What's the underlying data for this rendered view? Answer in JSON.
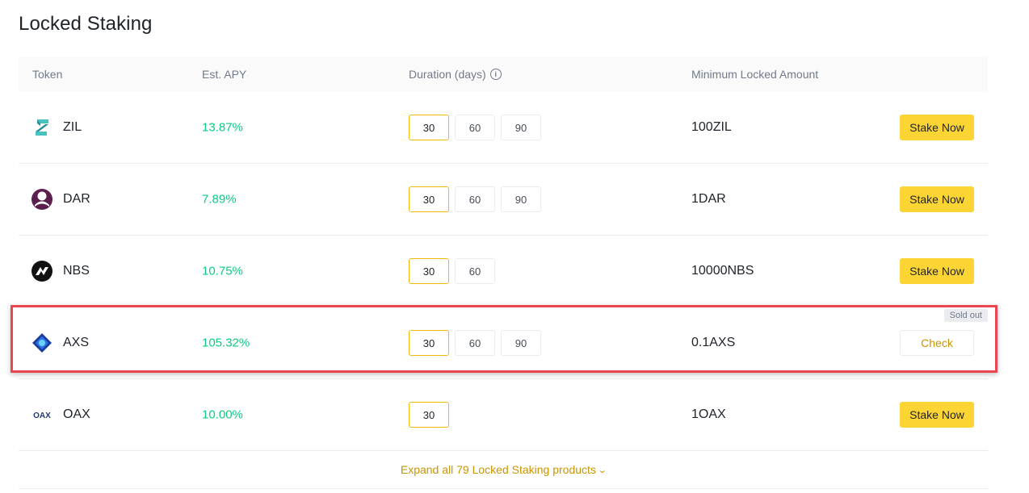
{
  "page_title": "Locked Staking",
  "columns": {
    "token": "Token",
    "apy": "Est. APY",
    "duration": "Duration (days)",
    "min_amount": "Minimum Locked Amount"
  },
  "rows": [
    {
      "token": "ZIL",
      "icon": "zil-icon",
      "apy": "13.87%",
      "durations": [
        "30",
        "60",
        "90"
      ],
      "selected": "30",
      "min": "100ZIL",
      "action": "Stake Now",
      "sold_out": false
    },
    {
      "token": "DAR",
      "icon": "dar-icon",
      "apy": "7.89%",
      "durations": [
        "30",
        "60",
        "90"
      ],
      "selected": "30",
      "min": "1DAR",
      "action": "Stake Now",
      "sold_out": false
    },
    {
      "token": "NBS",
      "icon": "nbs-icon",
      "apy": "10.75%",
      "durations": [
        "30",
        "60"
      ],
      "selected": "30",
      "min": "10000NBS",
      "action": "Stake Now",
      "sold_out": false
    },
    {
      "token": "AXS",
      "icon": "axs-icon",
      "apy": "105.32%",
      "durations": [
        "30",
        "60",
        "90"
      ],
      "selected": "30",
      "min": "0.1AXS",
      "action": "Check",
      "sold_out": true,
      "badge": "Sold out"
    },
    {
      "token": "OAX",
      "icon": "oax-icon",
      "apy": "10.00%",
      "durations": [
        "30"
      ],
      "selected": "30",
      "min": "1OAX",
      "action": "Stake Now",
      "sold_out": false
    }
  ],
  "expand_label": "Expand all 79 Locked Staking products",
  "colors": {
    "accent_yellow": "#fcd535",
    "apy_green": "#0ecb81",
    "link_gold": "#c99400",
    "highlight_red": "#e8474f"
  }
}
